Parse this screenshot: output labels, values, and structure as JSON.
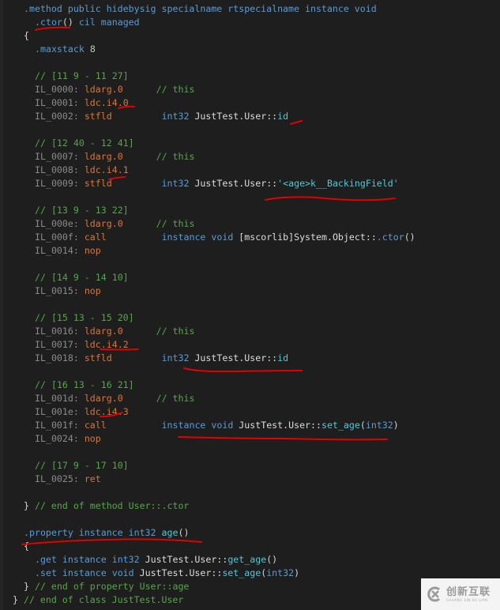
{
  "colors": {
    "background": "#1e1e1e",
    "keyword": "#569cd6",
    "opcode": "#d8763a",
    "label": "#8a8a8a",
    "comment": "#57a64a",
    "identifier": "#dcdcdc",
    "member": "#4ec9d8",
    "number": "#b5cea8",
    "annotation": "#e00000"
  },
  "lines": [
    {
      "indent": 2,
      "tokens": [
        {
          "t": ".method public hidebysig specialname rtspecialname instance void",
          "c": "kw"
        }
      ]
    },
    {
      "indent": 4,
      "tokens": [
        {
          "t": ".ctor",
          "c": "kw"
        },
        {
          "t": "()",
          "c": "br"
        },
        {
          "t": " cil managed",
          "c": "kw"
        }
      ]
    },
    {
      "indent": 2,
      "tokens": [
        {
          "t": "{",
          "c": "br"
        }
      ]
    },
    {
      "indent": 4,
      "tokens": [
        {
          "t": ".maxstack ",
          "c": "kw"
        },
        {
          "t": "8",
          "c": "num"
        }
      ]
    },
    {
      "indent": 0,
      "tokens": []
    },
    {
      "indent": 4,
      "tokens": [
        {
          "t": "// [11 9 - 11 27]",
          "c": "cm"
        }
      ]
    },
    {
      "indent": 4,
      "tokens": [
        {
          "t": "IL_0000: ",
          "c": "lbl"
        },
        {
          "t": "ldarg.0",
          "c": "op"
        },
        {
          "t": "      ",
          "c": "br"
        },
        {
          "t": "// this",
          "c": "cm"
        }
      ]
    },
    {
      "indent": 4,
      "tokens": [
        {
          "t": "IL_0001: ",
          "c": "lbl"
        },
        {
          "t": "ldc.i4.0",
          "c": "op"
        }
      ]
    },
    {
      "indent": 4,
      "tokens": [
        {
          "t": "IL_0002: ",
          "c": "lbl"
        },
        {
          "t": "stfld",
          "c": "op"
        },
        {
          "t": "         ",
          "c": "br"
        },
        {
          "t": "int32",
          "c": "kw"
        },
        {
          "t": " JustTest.User::",
          "c": "id"
        },
        {
          "t": "id",
          "c": "mb"
        }
      ]
    },
    {
      "indent": 0,
      "tokens": []
    },
    {
      "indent": 4,
      "tokens": [
        {
          "t": "// [12 40 - 12 41]",
          "c": "cm"
        }
      ]
    },
    {
      "indent": 4,
      "tokens": [
        {
          "t": "IL_0007: ",
          "c": "lbl"
        },
        {
          "t": "ldarg.0",
          "c": "op"
        },
        {
          "t": "      ",
          "c": "br"
        },
        {
          "t": "// this",
          "c": "cm"
        }
      ]
    },
    {
      "indent": 4,
      "tokens": [
        {
          "t": "IL_0008: ",
          "c": "lbl"
        },
        {
          "t": "ldc.i4.1",
          "c": "op"
        }
      ]
    },
    {
      "indent": 4,
      "tokens": [
        {
          "t": "IL_0009: ",
          "c": "lbl"
        },
        {
          "t": "stfld",
          "c": "op"
        },
        {
          "t": "         ",
          "c": "br"
        },
        {
          "t": "int32",
          "c": "kw"
        },
        {
          "t": " JustTest.User::",
          "c": "id"
        },
        {
          "t": "'<age>k__BackingField'",
          "c": "mb"
        }
      ]
    },
    {
      "indent": 0,
      "tokens": []
    },
    {
      "indent": 4,
      "tokens": [
        {
          "t": "// [13 9 - 13 22]",
          "c": "cm"
        }
      ]
    },
    {
      "indent": 4,
      "tokens": [
        {
          "t": "IL_000e: ",
          "c": "lbl"
        },
        {
          "t": "ldarg.0",
          "c": "op"
        },
        {
          "t": "      ",
          "c": "br"
        },
        {
          "t": "// this",
          "c": "cm"
        }
      ]
    },
    {
      "indent": 4,
      "tokens": [
        {
          "t": "IL_000f: ",
          "c": "lbl"
        },
        {
          "t": "call",
          "c": "op"
        },
        {
          "t": "          ",
          "c": "br"
        },
        {
          "t": "instance void",
          "c": "kw"
        },
        {
          "t": " [mscorlib]System.Object::",
          "c": "id"
        },
        {
          "t": ".ctor",
          "c": "kw"
        },
        {
          "t": "()",
          "c": "br"
        }
      ]
    },
    {
      "indent": 4,
      "tokens": [
        {
          "t": "IL_0014: ",
          "c": "lbl"
        },
        {
          "t": "nop",
          "c": "op"
        }
      ]
    },
    {
      "indent": 0,
      "tokens": []
    },
    {
      "indent": 4,
      "tokens": [
        {
          "t": "// [14 9 - 14 10]",
          "c": "cm"
        }
      ]
    },
    {
      "indent": 4,
      "tokens": [
        {
          "t": "IL_0015: ",
          "c": "lbl"
        },
        {
          "t": "nop",
          "c": "op"
        }
      ]
    },
    {
      "indent": 0,
      "tokens": []
    },
    {
      "indent": 4,
      "tokens": [
        {
          "t": "// [15 13 - 15 20]",
          "c": "cm"
        }
      ]
    },
    {
      "indent": 4,
      "tokens": [
        {
          "t": "IL_0016: ",
          "c": "lbl"
        },
        {
          "t": "ldarg.0",
          "c": "op"
        },
        {
          "t": "      ",
          "c": "br"
        },
        {
          "t": "// this",
          "c": "cm"
        }
      ]
    },
    {
      "indent": 4,
      "tokens": [
        {
          "t": "IL_0017: ",
          "c": "lbl"
        },
        {
          "t": "ldc.i4.2",
          "c": "op"
        }
      ]
    },
    {
      "indent": 4,
      "tokens": [
        {
          "t": "IL_0018: ",
          "c": "lbl"
        },
        {
          "t": "stfld",
          "c": "op"
        },
        {
          "t": "         ",
          "c": "br"
        },
        {
          "t": "int32",
          "c": "kw"
        },
        {
          "t": " JustTest.User::",
          "c": "id"
        },
        {
          "t": "id",
          "c": "mb"
        }
      ]
    },
    {
      "indent": 0,
      "tokens": []
    },
    {
      "indent": 4,
      "tokens": [
        {
          "t": "// [16 13 - 16 21]",
          "c": "cm"
        }
      ]
    },
    {
      "indent": 4,
      "tokens": [
        {
          "t": "IL_001d: ",
          "c": "lbl"
        },
        {
          "t": "ldarg.0",
          "c": "op"
        },
        {
          "t": "      ",
          "c": "br"
        },
        {
          "t": "// this",
          "c": "cm"
        }
      ]
    },
    {
      "indent": 4,
      "tokens": [
        {
          "t": "IL_001e: ",
          "c": "lbl"
        },
        {
          "t": "ldc.i4.3",
          "c": "op"
        }
      ]
    },
    {
      "indent": 4,
      "tokens": [
        {
          "t": "IL_001f: ",
          "c": "lbl"
        },
        {
          "t": "call",
          "c": "op"
        },
        {
          "t": "          ",
          "c": "br"
        },
        {
          "t": "instance void",
          "c": "kw"
        },
        {
          "t": " JustTest.User::",
          "c": "id"
        },
        {
          "t": "set_age",
          "c": "mb"
        },
        {
          "t": "(",
          "c": "br"
        },
        {
          "t": "int32",
          "c": "kw"
        },
        {
          "t": ")",
          "c": "br"
        }
      ]
    },
    {
      "indent": 4,
      "tokens": [
        {
          "t": "IL_0024: ",
          "c": "lbl"
        },
        {
          "t": "nop",
          "c": "op"
        }
      ]
    },
    {
      "indent": 0,
      "tokens": []
    },
    {
      "indent": 4,
      "tokens": [
        {
          "t": "// [17 9 - 17 10]",
          "c": "cm"
        }
      ]
    },
    {
      "indent": 4,
      "tokens": [
        {
          "t": "IL_0025: ",
          "c": "lbl"
        },
        {
          "t": "ret",
          "c": "op"
        }
      ]
    },
    {
      "indent": 0,
      "tokens": []
    },
    {
      "indent": 2,
      "tokens": [
        {
          "t": "} ",
          "c": "br"
        },
        {
          "t": "// end of method User::.ctor",
          "c": "cm"
        }
      ]
    },
    {
      "indent": 0,
      "tokens": []
    },
    {
      "indent": 2,
      "tokens": [
        {
          "t": ".property instance int32 ",
          "c": "kw"
        },
        {
          "t": "age",
          "c": "mb"
        },
        {
          "t": "()",
          "c": "br"
        }
      ]
    },
    {
      "indent": 2,
      "tokens": [
        {
          "t": "{",
          "c": "br"
        }
      ]
    },
    {
      "indent": 4,
      "tokens": [
        {
          "t": ".get instance int32",
          "c": "kw"
        },
        {
          "t": " JustTest.User::",
          "c": "id"
        },
        {
          "t": "get_age",
          "c": "mb"
        },
        {
          "t": "()",
          "c": "br"
        }
      ]
    },
    {
      "indent": 4,
      "tokens": [
        {
          "t": ".set instance void",
          "c": "kw"
        },
        {
          "t": " JustTest.User::",
          "c": "id"
        },
        {
          "t": "set_age",
          "c": "mb"
        },
        {
          "t": "(",
          "c": "br"
        },
        {
          "t": "int32",
          "c": "kw"
        },
        {
          "t": ")",
          "c": "br"
        }
      ]
    },
    {
      "indent": 2,
      "tokens": [
        {
          "t": "} ",
          "c": "br"
        },
        {
          "t": "// end of property User::age",
          "c": "cm"
        }
      ]
    },
    {
      "indent": 0,
      "tokens": [
        {
          "t": "} ",
          "c": "br"
        },
        {
          "t": "// end of class JustTest.User",
          "c": "cm"
        }
      ]
    }
  ],
  "watermark": {
    "chinese": "创新互联",
    "english": "CHUANG XIN HU LIAN"
  }
}
